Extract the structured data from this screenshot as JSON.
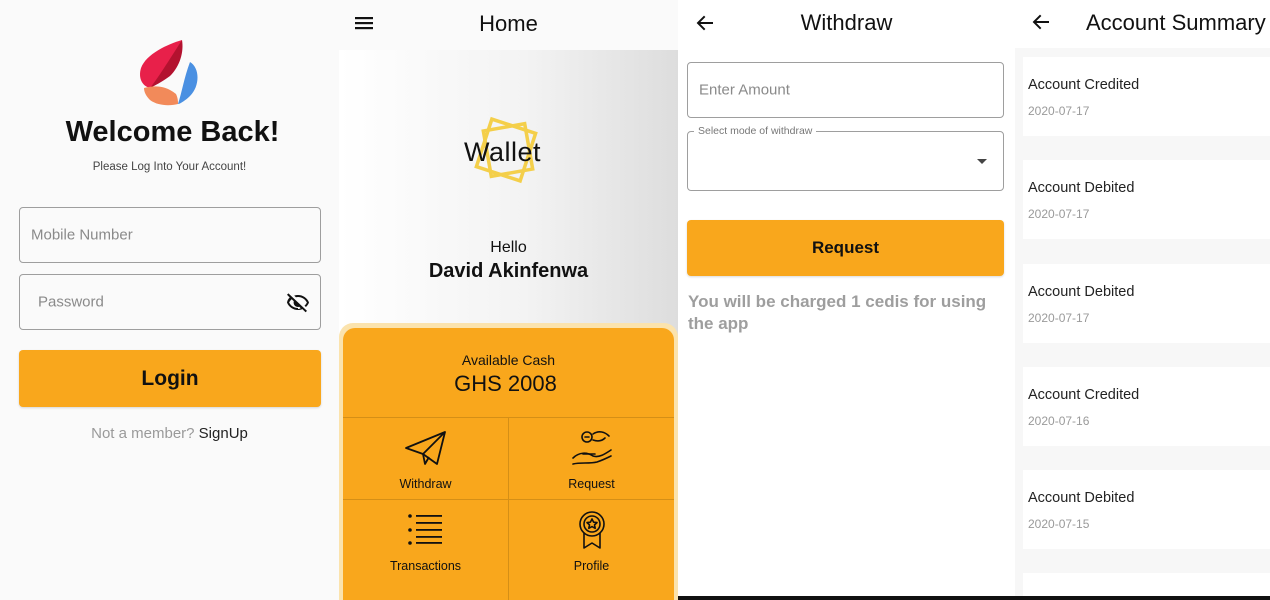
{
  "login": {
    "welcome": "Welcome Back!",
    "subtitle": "Please Log Into Your Account!",
    "mobile_placeholder": "Mobile Number",
    "password_placeholder": "Password",
    "login_label": "Login",
    "not_member": "Not a member?",
    "signup_label": "SignUp",
    "icons": [
      "app-logo-icon",
      "visibility-off-icon"
    ]
  },
  "home": {
    "title": "Home",
    "logo_text": "Wallet",
    "greeting": "Hello",
    "user_name": "David Akinfenwa",
    "cash_label": "Available Cash",
    "cash_value": "GHS 2008",
    "tiles": [
      {
        "label": "Withdraw",
        "icon": "paper-plane-icon"
      },
      {
        "label": "Request",
        "icon": "hand-coin-icon"
      },
      {
        "label": "Transactions",
        "icon": "list-icon"
      },
      {
        "label": "Profile",
        "icon": "award-badge-icon"
      }
    ],
    "icons": [
      "menu-icon"
    ]
  },
  "withdraw": {
    "title": "Withdraw",
    "amount_placeholder": "Enter Amount",
    "mode_label": "Select  mode of withdraw",
    "request_label": "Request",
    "note": "You will be charged 1 cedis for using the app",
    "icons": [
      "back-arrow-icon",
      "dropdown-caret-icon"
    ]
  },
  "summary": {
    "title": "Account Summary",
    "entries": [
      {
        "title": "Account Credited",
        "date": "2020-07-17"
      },
      {
        "title": "Account Debited",
        "date": "2020-07-17"
      },
      {
        "title": "Account Debited",
        "date": "2020-07-17"
      },
      {
        "title": "Account Credited",
        "date": "2020-07-16"
      },
      {
        "title": "Account Debited",
        "date": "2020-07-15"
      }
    ],
    "icons": [
      "back-arrow-icon"
    ]
  },
  "colors": {
    "accent": "#f9a71c",
    "accent_glow": "#fbe3ad",
    "muted_text": "#9e9e9e"
  }
}
